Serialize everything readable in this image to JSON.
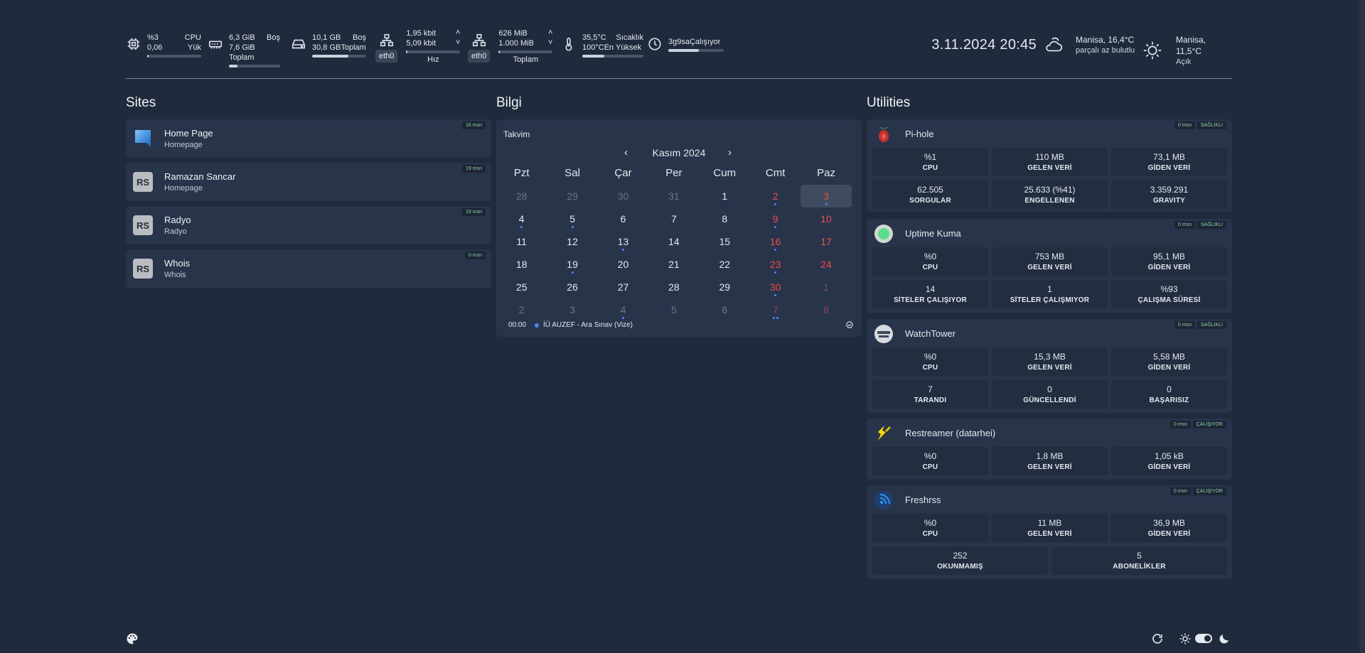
{
  "top": {
    "cpu": {
      "a": "%3",
      "b": "CPU",
      "c": "0,06",
      "d": "Yük",
      "fill": 0.03
    },
    "mem": {
      "a": "6,3 GiB",
      "b": "Boş",
      "c": "7,6 GiB Toplam",
      "fill": 0.17
    },
    "disk": {
      "a": "10,1 GB",
      "b": "Boş",
      "c": "30,8 GB",
      "d": "Toplam",
      "fill": 0.67
    },
    "net1": {
      "iface": "eth0",
      "up": "1,95 kbit",
      "down": "5,09 kbit",
      "label": "Hız",
      "fill": 0.02
    },
    "net2": {
      "iface": "eth0",
      "up": "626 MiB",
      "down": "1.000 MiB",
      "label": "Toplam",
      "fill": 0.02
    },
    "temp": {
      "a": "35,5°C",
      "b": "Sıcaklık",
      "c": "100°C",
      "d": "En Yüksek",
      "fill": 0.36
    },
    "uptime": {
      "a": "3g9sa",
      "b": "Çalışıyor",
      "fill": 0.55
    },
    "datetime": "3.11.2024 20:45",
    "weather1": {
      "loc": "Manisa, 16,4°C",
      "desc": "parçalı az bulutlu",
      "icon": "cloud-sun-icon"
    },
    "weather2": {
      "loc": "Manisa, 11,5°C",
      "desc": "Açık",
      "icon": "sun-icon"
    }
  },
  "sections": {
    "sites": "Sites",
    "info": "Bilgi",
    "utilities": "Utilities"
  },
  "sites": [
    {
      "name": "Home Page",
      "desc": "Homepage",
      "badge": "16 msn",
      "logo": ""
    },
    {
      "name": "Ramazan Sancar",
      "desc": "Homepage",
      "badge": "19 msn",
      "logo": "RS"
    },
    {
      "name": "Radyo",
      "desc": "Radyo",
      "badge": "19 msn",
      "logo": "RS"
    },
    {
      "name": "Whois",
      "desc": "Whois",
      "badge": "0 msn",
      "logo": "RS"
    }
  ],
  "calendar": {
    "title": "Takvim",
    "month": "Kasım 2024",
    "prev": "‹",
    "next": "›",
    "weekdays": [
      "Pzt",
      "Sal",
      "Çar",
      "Per",
      "Cum",
      "Cmt",
      "Paz"
    ],
    "weeks": [
      [
        "28",
        "29",
        "30",
        "31",
        "1",
        "2",
        "3"
      ],
      [
        "4",
        "5",
        "6",
        "7",
        "8",
        "9",
        "10"
      ],
      [
        "11",
        "12",
        "13",
        "14",
        "15",
        "16",
        "17"
      ],
      [
        "18",
        "19",
        "20",
        "21",
        "22",
        "23",
        "24"
      ],
      [
        "25",
        "26",
        "27",
        "28",
        "29",
        "30",
        "1"
      ],
      [
        "2",
        "3",
        "4",
        "5",
        "6",
        "7",
        "8"
      ]
    ],
    "event": {
      "time": "00:00",
      "text": "İÜ AUZEF - Ara Sınav (Vize)"
    }
  },
  "utilities": [
    {
      "name": "Pi-hole",
      "badge1": "0 msn",
      "badge2": "SAĞLIKLI",
      "rows": [
        [
          {
            "v": "%1",
            "l": "CPU"
          },
          {
            "v": "110 MB",
            "l": "GELEN VERİ"
          },
          {
            "v": "73,1 MB",
            "l": "GİDEN VERİ"
          }
        ],
        [
          {
            "v": "62.505",
            "l": "SORGULAR"
          },
          {
            "v": "25.633 (%41)",
            "l": "ENGELLENEN"
          },
          {
            "v": "3.359.291",
            "l": "GRAVITY"
          }
        ]
      ]
    },
    {
      "name": "Uptime Kuma",
      "badge1": "0 msn",
      "badge2": "SAĞLIKLI",
      "rows": [
        [
          {
            "v": "%0",
            "l": "CPU"
          },
          {
            "v": "753 MB",
            "l": "GELEN VERİ"
          },
          {
            "v": "95,1 MB",
            "l": "GİDEN VERİ"
          }
        ],
        [
          {
            "v": "14",
            "l": "SİTELER ÇALIŞIYOR"
          },
          {
            "v": "1",
            "l": "SİTELER ÇALIŞMIYOR"
          },
          {
            "v": "%93",
            "l": "ÇALIŞMA SÜRESİ"
          }
        ]
      ]
    },
    {
      "name": "WatchTower",
      "badge1": "0 msn",
      "badge2": "SAĞLIKLI",
      "rows": [
        [
          {
            "v": "%0",
            "l": "CPU"
          },
          {
            "v": "15,3 MB",
            "l": "GELEN VERİ"
          },
          {
            "v": "5,58 MB",
            "l": "GİDEN VERİ"
          }
        ],
        [
          {
            "v": "7",
            "l": "TARANDI"
          },
          {
            "v": "0",
            "l": "GÜNCELLENDİ"
          },
          {
            "v": "0",
            "l": "BAŞARISIZ"
          }
        ]
      ]
    },
    {
      "name": "Restreamer (datarhei)",
      "badge1": "0 msn",
      "badge2": "ÇALIŞIYOR",
      "rows": [
        [
          {
            "v": "%0",
            "l": "CPU"
          },
          {
            "v": "1,8 MB",
            "l": "GELEN VERİ"
          },
          {
            "v": "1,05 kB",
            "l": "GİDEN VERİ"
          }
        ]
      ]
    },
    {
      "name": "Freshrss",
      "badge1": "0 msn",
      "badge2": "ÇALIŞIYOR",
      "rows": [
        [
          {
            "v": "%0",
            "l": "CPU"
          },
          {
            "v": "11 MB",
            "l": "GELEN VERİ"
          },
          {
            "v": "36,9 MB",
            "l": "GİDEN VERİ"
          }
        ],
        [
          {
            "v": "252",
            "l": "OKUNMAMIŞ"
          },
          {
            "v": "5",
            "l": "ABONELİKLER"
          }
        ]
      ]
    }
  ]
}
